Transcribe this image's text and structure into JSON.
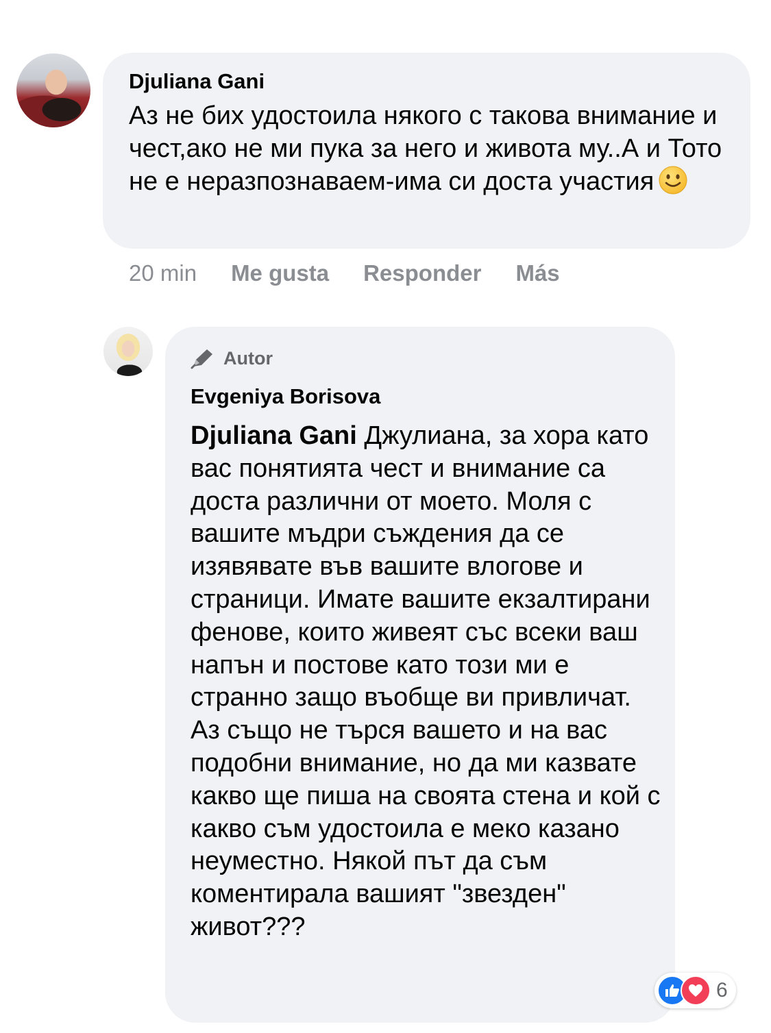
{
  "comment_1": {
    "author": "Djuliana Gani",
    "text": "Аз не бих удостоила някого с такова внимание и чест,ако не ми пука за него и живота му..А и Тото не е неразпознаваем-има си доста участия",
    "emoji_icon": "slightly-smiling-face-icon",
    "time": "20 min",
    "actions": {
      "like": "Me gusta",
      "reply": "Responder",
      "more": "Más"
    }
  },
  "comment_2": {
    "badge": "Autor",
    "badge_icon": "pen-icon",
    "author": "Evgeniya Borisova",
    "mention": "Djuliana Gani",
    "text": "Джулиана, за хора като вас понятията чест и внимание са доста различни от моето. Моля с вашите мъдри съждения да се изявявате във вашите влогове и страници. Имате вашите екзалтирани фенове, които живеят със всеки ваш напън и постове като този ми е странно защо въобще ви привличат. Аз също не търся вашето и на вас подобни внимание, но да ми казвате какво ще пиша на своята стена и кой с какво съм удостоила е меко казано неуместно. Някой път да съм коментирала вашият \"звезден\" живот???",
    "reactions": {
      "icons": [
        "like-icon",
        "love-icon"
      ],
      "count": "6"
    }
  },
  "colors": {
    "bubble": "#f0f2f5",
    "meta_text": "#8a8d91",
    "like_blue": "#1877f2",
    "love_red": "#f33e58"
  }
}
